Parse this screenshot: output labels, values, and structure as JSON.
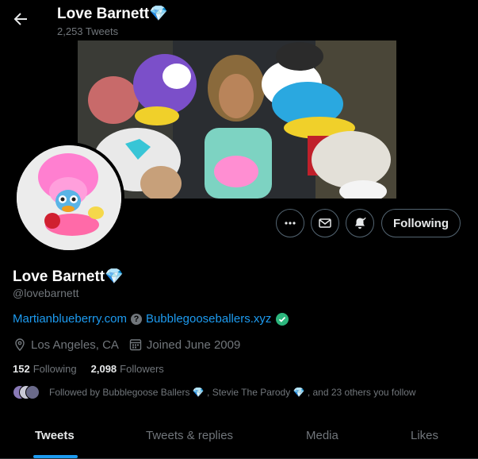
{
  "header": {
    "title": "Love Barnett💎",
    "tweet_count": "2,253 Tweets"
  },
  "profile": {
    "name": "Love Barnett💎",
    "handle": "@lovebarnett",
    "link_primary": "Martianblueberry.com",
    "link_secondary": "Bubblegooseballers.xyz",
    "location": "Los Angeles, CA",
    "joined": "Joined June 2009"
  },
  "actions": {
    "following_label": "Following"
  },
  "stats": {
    "following_count": "152",
    "following_label": "Following",
    "followers_count": "2,098",
    "followers_label": "Followers"
  },
  "followed_by": "Followed by Bubblegoose Ballers 💎 , Stevie The Parody 💎 , and 23 others you follow",
  "tabs": [
    {
      "label": "Tweets"
    },
    {
      "label": "Tweets & replies"
    },
    {
      "label": "Media"
    },
    {
      "label": "Likes"
    }
  ],
  "colors": {
    "accent": "#1d9bf0",
    "muted": "#71767b",
    "verified": "#2cb67d"
  }
}
